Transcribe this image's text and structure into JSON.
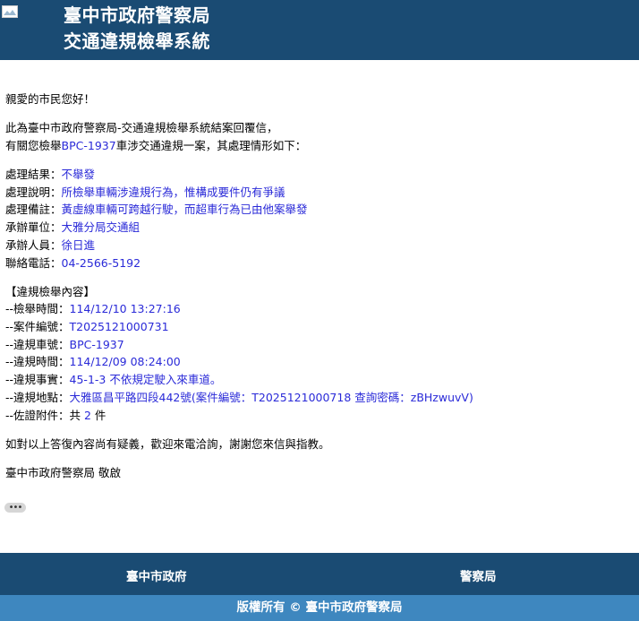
{
  "header": {
    "title_line1": "臺中市政府警察局",
    "title_line2": "交通違規檢舉系統"
  },
  "message": {
    "greeting": "親愛的市民您好！",
    "intro_line1": "此為臺中市政府警察局-交通違規檢舉系統結案回覆信，",
    "intro_prefix": "有關您檢舉",
    "intro_plate": "BPC-1937",
    "intro_suffix": "車涉交通違規一案，其處理情形如下：",
    "result_fields": [
      {
        "label": "處理結果：",
        "value": "不舉發"
      },
      {
        "label": "處理說明：",
        "value": "所檢舉車輛涉違規行為，惟構成要件仍有爭議"
      },
      {
        "label": "處理備註：",
        "value": "黃虛線車輛可跨越行駛，而超車行為已由他案舉發"
      },
      {
        "label": "承辦單位：",
        "value": "大雅分局交通組"
      },
      {
        "label": "承辦人員：",
        "value": "徐日進"
      },
      {
        "label": "聯絡電話：",
        "value": "04-2566-5192"
      }
    ],
    "report_heading": "【違規檢舉內容】",
    "report_fields": [
      {
        "label": "--檢舉時間：",
        "value": "114/12/10 13:27:16"
      },
      {
        "label": "--案件編號：",
        "value": "T2025121000731"
      },
      {
        "label": "--違規車號：",
        "value": "BPC-1937"
      },
      {
        "label": "--違規時間：",
        "value": "114/12/09 08:24:00"
      },
      {
        "label": "--違規事實：",
        "value": "45-1-3 不依規定駛入來車道。"
      },
      {
        "label": "--違規地點：",
        "value": "大雅區昌平路四段442號(案件編號：T2025121000718 查詢密碼：zBHzwuvV)"
      }
    ],
    "attachments_label": "--佐證附件：共 ",
    "attachments_count": "2",
    "attachments_unit": " 件",
    "closing": "如對以上答復內容尚有疑義，歡迎來電洽詢，謝謝您來信與指教。",
    "signature": "臺中市政府警察局 敬啟"
  },
  "ellipsis_label": "•••",
  "footer": {
    "links": [
      "臺中市政府",
      "警察局"
    ],
    "copyright": "版權所有 © 臺中市政府警察局"
  }
}
